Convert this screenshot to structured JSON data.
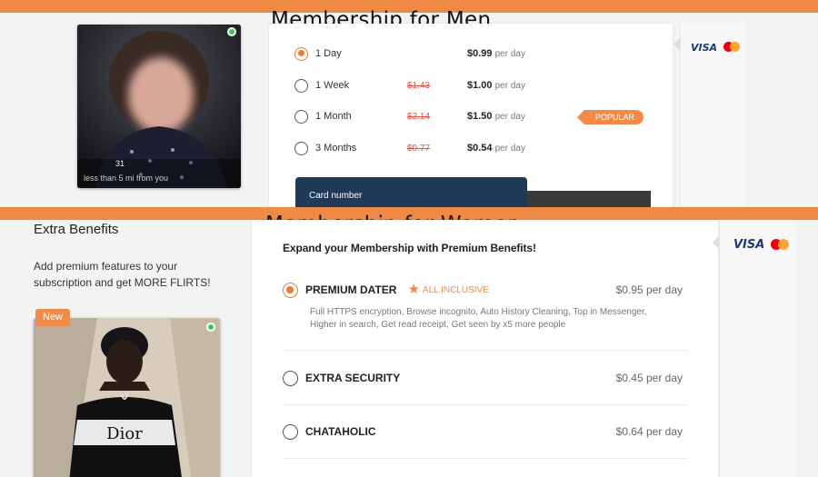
{
  "top_panel": {
    "heading": "Membership for Men",
    "profile": {
      "age": "31",
      "distance": "less than 5 mi from you"
    },
    "plans": [
      {
        "label": "1 Day",
        "old_price": "",
        "price": "$0.99",
        "per": "per day",
        "selected": true
      },
      {
        "label": "1 Week",
        "old_price": "$1.43",
        "price": "$1.00",
        "per": "per day",
        "selected": false
      },
      {
        "label": "1 Month",
        "old_price": "$2.14",
        "price": "$1.50",
        "per": "per day",
        "selected": false
      },
      {
        "label": "3 Months",
        "old_price": "$0.77",
        "price": "$0.54",
        "per": "per day",
        "selected": false
      }
    ],
    "popular_badge": "POPULAR",
    "card_label": "Card number",
    "payment_brand": "VISA"
  },
  "bottom_panel": {
    "heading": "Membership for Women",
    "extra_title": "Extra Benefits",
    "extra_text": "Add premium features to your subscription and get MORE FLIRTS!",
    "new_badge": "New",
    "expand_text": "Expand your Membership with Premium Benefits!",
    "benefits": [
      {
        "name": "PREMIUM DATER",
        "tag": "ALL INCLUSIVE",
        "price": "$0.95 per day",
        "selected": true,
        "description": "Full HTTPS encryption, Browse incognito, Auto History Cleaning, Top in Messenger, Higher in search, Get read receipt, Get seen by x5 more people"
      },
      {
        "name": "EXTRA SECURITY",
        "tag": "",
        "price": "$0.45 per day",
        "selected": false,
        "description": ""
      },
      {
        "name": "CHATAHOLIC",
        "tag": "",
        "price": "$0.64 per day",
        "selected": false,
        "description": ""
      }
    ],
    "payment_brand": "VISA"
  },
  "colors": {
    "accent_orange": "#ef8a45",
    "radio_selected": "#ef7a30",
    "strike_red": "#e0574c",
    "card_navy": "#1f3957",
    "visa_blue": "#1a3a7a",
    "online_green": "#41c35a"
  },
  "icons": [
    "radio-selected-icon",
    "radio-icon",
    "star-icon",
    "visa-logo",
    "mastercard-logo",
    "online-status-icon"
  ]
}
